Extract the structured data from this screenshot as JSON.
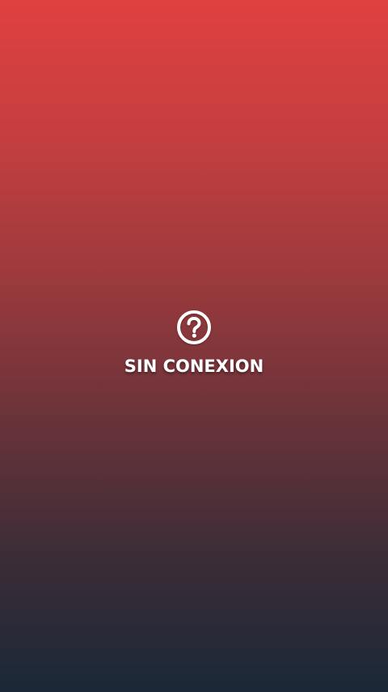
{
  "status": {
    "icon": "question-circle-icon",
    "message": "SIN CONEXION"
  },
  "colors": {
    "gradient_top": "#e04040",
    "gradient_bottom": "#1b2837",
    "text": "#ffffff"
  }
}
